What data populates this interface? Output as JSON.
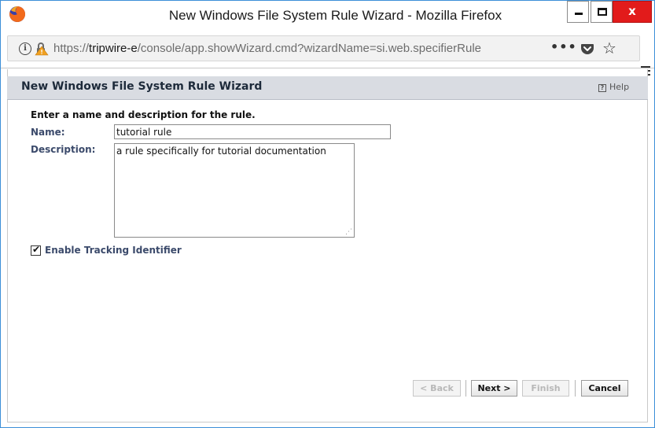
{
  "window": {
    "title": "New Windows File System Rule Wizard - Mozilla Firefox",
    "close_glyph": "x"
  },
  "browser": {
    "url_prefix": "https://",
    "url_host": "tripwire-e",
    "url_path": "/console/app.showWizard.cmd?wizardName=si.web.specifierRule",
    "more_glyph": "•••",
    "star_glyph": "☆",
    "info_glyph": "i"
  },
  "wizard": {
    "title": "New Windows File System Rule Wizard",
    "help_label": "Help",
    "help_glyph": "?",
    "prompt": "Enter a name and description for the rule.",
    "name_label": "Name:",
    "name_value": "tutorial rule",
    "description_label": "Description:",
    "description_value": "a rule specifically for tutorial documentation",
    "tracking_label": "Enable Tracking Identifier",
    "tracking_checked": true,
    "check_glyph": "✔",
    "grip_glyph": "⋰"
  },
  "buttons": {
    "back": "< Back",
    "next": "Next >",
    "finish": "Finish",
    "cancel": "Cancel"
  },
  "colors": {
    "window_border": "#3c8fd8",
    "close_button": "#e21b1b",
    "header_band": "#d9dce2",
    "label_text": "#3b4a6b",
    "lock_warning": "#f0a020"
  },
  "icons": [
    "firefox-logo-icon",
    "minimize-icon",
    "maximize-icon",
    "close-icon",
    "info-icon",
    "insecure-lock-icon",
    "page-actions-icon",
    "pocket-icon",
    "bookmark-star-icon",
    "menu-icon",
    "help-icon",
    "checkbox-icon"
  ]
}
